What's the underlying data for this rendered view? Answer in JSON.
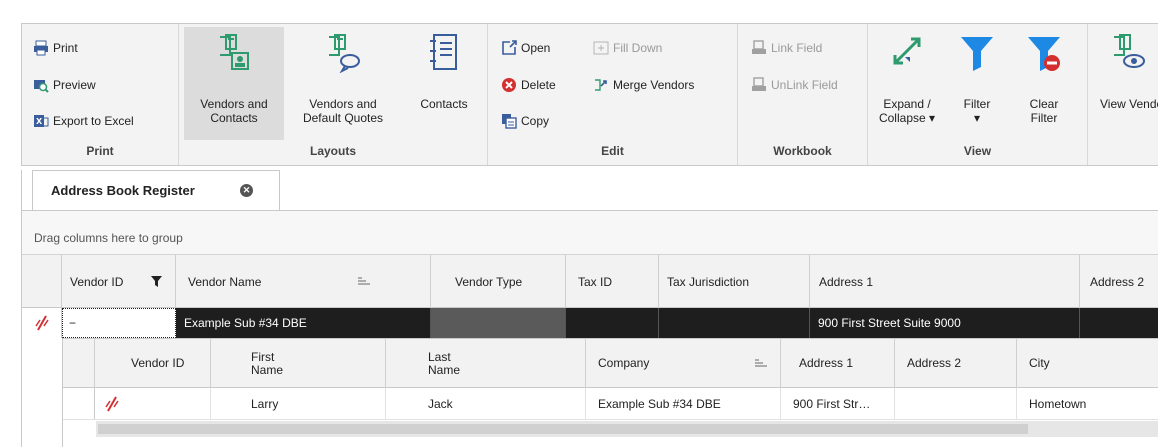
{
  "ribbon": {
    "print_group": {
      "caption": "Print",
      "print": "Print",
      "preview": "Preview",
      "export": "Export to Excel",
      "icons": [
        "printer-icon",
        "preview-icon",
        "excel-export-icon"
      ]
    },
    "layouts_group": {
      "caption": "Layouts",
      "vendors_contacts": "Vendors and\nContacts",
      "vendors_quotes": "Vendors and\nDefault Quotes",
      "contacts": "Contacts"
    },
    "edit_group": {
      "caption": "Edit",
      "open": "Open",
      "delete": "Delete",
      "copy": "Copy",
      "fill_down": "Fill Down",
      "merge_vendors": "Merge Vendors"
    },
    "workbook_group": {
      "caption": "Workbook",
      "link_field": "Link Field",
      "unlink_field": "UnLink Field"
    },
    "view_group": {
      "caption": "View",
      "expand": "Expand /\nCollapse ▾",
      "filter": "Filter\n▾",
      "clear_filter": "Clear\nFilter",
      "view_vendor": "View Vendo"
    }
  },
  "tab": {
    "label": "Address Book Register",
    "close": "✕"
  },
  "grid": {
    "group_panel": "Drag columns here to group",
    "columns": [
      "Vendor ID",
      "Vendor Name",
      "Vendor Type",
      "Tax ID",
      "Tax Jurisdiction",
      "Address 1",
      "Address 2"
    ],
    "row": {
      "expander": "−",
      "vendor_id": "",
      "vendor_name": "Example Sub #34 DBE",
      "vendor_type": "",
      "tax_id": "",
      "tax_jurisdiction": "",
      "address1": "900 First Street Suite 9000",
      "address2": ""
    },
    "detail": {
      "columns": [
        "Vendor ID",
        "First\nName",
        "Last\nName",
        "Company",
        "Address 1",
        "Address 2",
        "City"
      ],
      "row": {
        "vendor_id": "",
        "first_name": "Larry",
        "last_name": "Jack",
        "company": "Example Sub #34 DBE",
        "address1": "900 First Str…",
        "address2": "",
        "city": "Hometown"
      }
    }
  },
  "colors": {
    "accent": "#1e88e5",
    "teal": "#2e9b6e",
    "selected_row": "#1e1e1e",
    "delete_red": "#d32f2f"
  }
}
